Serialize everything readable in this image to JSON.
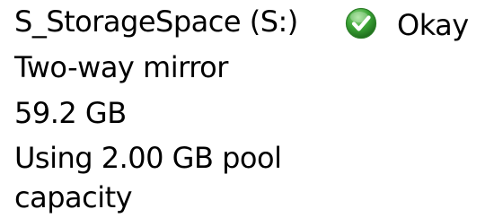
{
  "storage_space": {
    "name": "S_StorageSpace (S:)",
    "resiliency": "Two-way mirror",
    "size": "59.2 GB",
    "usage_line1": "Using 2.00 GB pool",
    "usage_line2": "capacity"
  },
  "status": {
    "label": "Okay",
    "icon": "checkmark-icon",
    "color": "#3aa335"
  }
}
